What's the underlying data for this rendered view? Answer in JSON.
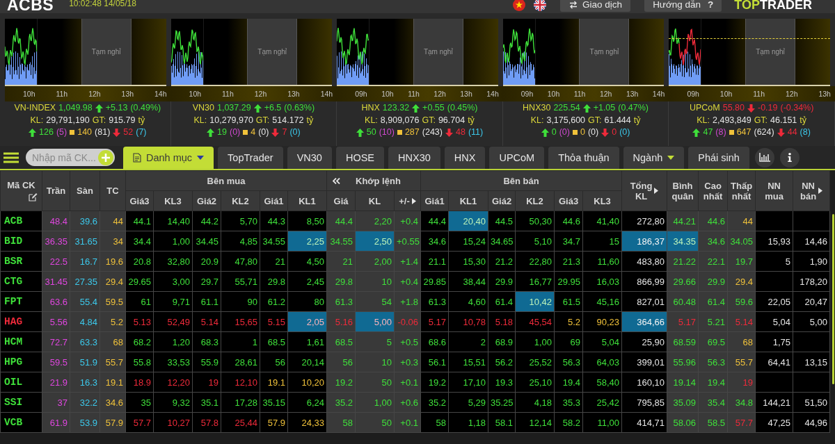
{
  "top_bar": {
    "logo": "ACBS",
    "clock": "10:02:48 14/05/18",
    "buttons": [
      {
        "kind": "trade",
        "label": "Giao dịch"
      },
      {
        "kind": "help",
        "label": "Hướng dẫn",
        "suffix": "?"
      }
    ],
    "brand": {
      "lead": "TOP",
      "rest": "TRADER"
    }
  },
  "indices": [
    {
      "name": "VN-INDEX",
      "value": "1,049.98",
      "kind": "up",
      "change": "+5.13",
      "percent": "(0.49%)",
      "volume_label": "KL:",
      "volume": "29,791,190",
      "turnover_label": "GT:",
      "turnover": "915.79",
      "unit": "tỷ",
      "advances": "126",
      "ceiling": "(5)",
      "unchanged": "140",
      "unchanged_note": "(81)",
      "declines": "52",
      "floor": "(7)",
      "pause_label": "Tạm nghỉ",
      "x_labels": [
        "10h",
        "11h",
        "12h",
        "13h",
        "14h"
      ]
    },
    {
      "name": "VN30",
      "value": "1,037.29",
      "kind": "up",
      "change": "+6.5",
      "percent": "(0.63%)",
      "volume_label": "KL:",
      "volume": "10,279,970",
      "turnover_label": "GT:",
      "turnover": "514.172",
      "unit": "tỷ",
      "advances": "19",
      "ceiling": "(0)",
      "unchanged": "4",
      "unchanged_note": "(0)",
      "declines": "7",
      "floor": "(0)",
      "pause_label": "Tạm nghỉ",
      "x_labels": [
        "10h",
        "11h",
        "12h",
        "13h",
        "14h"
      ]
    },
    {
      "name": "HNX",
      "value": "123.32",
      "kind": "up",
      "change": "+0.55",
      "percent": "(0.45%)",
      "volume_label": "KL:",
      "volume": "8,909,076",
      "turnover_label": "GT:",
      "turnover": "96.704",
      "unit": "tỷ",
      "advances": "50",
      "ceiling": "(10)",
      "unchanged": "287",
      "unchanged_note": "(243)",
      "declines": "48",
      "floor": "(11)",
      "pause_label": "Tạm nghỉ",
      "x_labels": [
        "09h",
        "10h",
        "11h",
        "12h",
        "13h",
        "14h"
      ]
    },
    {
      "name": "HNX30",
      "value": "225.54",
      "kind": "up",
      "change": "+1.05",
      "percent": "(0.47%)",
      "volume_label": "KL:",
      "volume": "3,175,600",
      "turnover_label": "GT:",
      "turnover": "61.444",
      "unit": "tỷ",
      "advances": "0",
      "ceiling": "(0)",
      "unchanged": "0",
      "unchanged_note": "(0)",
      "declines": "0",
      "floor": "(0)",
      "pause_label": "Tạm nghỉ",
      "x_labels": [
        "09h",
        "10h",
        "11h",
        "12h",
        "13h",
        "14h"
      ]
    },
    {
      "name": "UPCoM",
      "value": "55.80",
      "kind": "down",
      "change": "-0.19",
      "percent": "(-0.34%)",
      "volume_label": "KL:",
      "volume": "2,493,849",
      "turnover_label": "GT:",
      "turnover": "46.151",
      "unit": "tỷ",
      "advances": "47",
      "ceiling": "(8)",
      "unchanged": "647",
      "unchanged_note": "(624)",
      "declines": "44",
      "floor": "(8)",
      "pause_label": "Tạm nghỉ",
      "x_labels": [
        "09h",
        "10h",
        "11h",
        "12h",
        "13h"
      ]
    }
  ],
  "toolbar": {
    "search": {
      "placeholder": "Nhập mã CK..."
    },
    "tabs": [
      {
        "label": "Danh mục",
        "kind": "list",
        "selected": true
      },
      {
        "label": "TopTrader",
        "kind": "plain",
        "selected": false
      },
      {
        "label": "VN30",
        "kind": "plain",
        "selected": false
      },
      {
        "label": "HOSE",
        "kind": "plain",
        "selected": false
      },
      {
        "label": "HNX30",
        "kind": "plain",
        "selected": false
      },
      {
        "label": "HNX",
        "kind": "plain",
        "selected": false
      },
      {
        "label": "UPCoM",
        "kind": "plain",
        "selected": false
      },
      {
        "label": "Thỏa thuận",
        "kind": "plain",
        "selected": false
      },
      {
        "label": "Ngành",
        "kind": "menu",
        "selected": false
      },
      {
        "label": "Phái sinh",
        "kind": "plain",
        "selected": false
      }
    ]
  },
  "table": {
    "column_groups": [
      {
        "colspan": 4
      },
      {
        "label": "Bên mua",
        "kind": "plain",
        "colspan": 6
      },
      {
        "label": "Khớp lệnh",
        "kind": "collapse",
        "colspan": 3
      },
      {
        "label": "Bên bán",
        "kind": "plain",
        "colspan": 6
      },
      {
        "colspan": 6
      }
    ],
    "columns": [
      {
        "label": "Mã CK",
        "kind": "edit"
      },
      {
        "label": "Trần",
        "kind": "plain"
      },
      {
        "label": "Sàn",
        "kind": "plain"
      },
      {
        "label": "TC",
        "kind": "plain"
      },
      {
        "label": "Giá3",
        "kind": "plain"
      },
      {
        "label": "KL3",
        "kind": "plain"
      },
      {
        "label": "Giá2",
        "kind": "plain"
      },
      {
        "label": "KL2",
        "kind": "plain"
      },
      {
        "label": "Giá1",
        "kind": "plain"
      },
      {
        "label": "KL1",
        "kind": "plain"
      },
      {
        "label": "Giá",
        "kind": "plain"
      },
      {
        "label": "KL",
        "kind": "plain"
      },
      {
        "label": "+/-",
        "kind": "expand"
      },
      {
        "label": "Giá1",
        "kind": "plain"
      },
      {
        "label": "KL1",
        "kind": "plain"
      },
      {
        "label": "Giá2",
        "kind": "plain"
      },
      {
        "label": "KL2",
        "kind": "plain"
      },
      {
        "label": "Giá3",
        "kind": "plain"
      },
      {
        "label": "KL3",
        "kind": "plain"
      },
      {
        "label": "Tổng KL",
        "kind": "expand"
      },
      {
        "label": "Bình quân",
        "kind": "plain"
      },
      {
        "label": "Cao nhất",
        "kind": "plain"
      },
      {
        "label": "Thấp nhất",
        "kind": "plain"
      },
      {
        "label": "NN mua",
        "kind": "plain"
      },
      {
        "label": "NN bán",
        "kind": "expand"
      }
    ],
    "rows": [
      {
        "cells": [
          {
            "text": "ACB",
            "kind": "up",
            "flash": false
          },
          {
            "text": "48.4",
            "kind": "ceiling",
            "flash": false
          },
          {
            "text": "39.6",
            "kind": "floor",
            "flash": false
          },
          {
            "text": "44",
            "kind": "ref",
            "flash": false
          },
          {
            "text": "44.1",
            "kind": "up",
            "flash": false
          },
          {
            "text": "14,40",
            "kind": "up",
            "flash": false
          },
          {
            "text": "44.2",
            "kind": "up",
            "flash": false
          },
          {
            "text": "5,70",
            "kind": "up",
            "flash": false
          },
          {
            "text": "44.3",
            "kind": "up",
            "flash": false
          },
          {
            "text": "8,50",
            "kind": "up",
            "flash": false
          },
          {
            "text": "44.4",
            "kind": "up",
            "flash": false
          },
          {
            "text": "2,20",
            "kind": "up",
            "flash": false
          },
          {
            "text": "+0.4",
            "kind": "up",
            "flash": false
          },
          {
            "text": "44.4",
            "kind": "up",
            "flash": false
          },
          {
            "text": "20,40",
            "kind": "up",
            "flash": true
          },
          {
            "text": "44.5",
            "kind": "up",
            "flash": false
          },
          {
            "text": "50,30",
            "kind": "up",
            "flash": false
          },
          {
            "text": "44.6",
            "kind": "up",
            "flash": false
          },
          {
            "text": "41,40",
            "kind": "up",
            "flash": false
          },
          {
            "text": "272,80",
            "kind": "plain",
            "flash": false
          },
          {
            "text": "44.21",
            "kind": "up",
            "flash": false
          },
          {
            "text": "44.6",
            "kind": "up",
            "flash": false
          },
          {
            "text": "44",
            "kind": "ref",
            "flash": false
          },
          {
            "flash": false
          },
          {
            "flash": false
          }
        ]
      },
      {
        "cells": [
          {
            "text": "BID",
            "kind": "up",
            "flash": false
          },
          {
            "text": "36.35",
            "kind": "ceiling",
            "flash": false
          },
          {
            "text": "31.65",
            "kind": "floor",
            "flash": false
          },
          {
            "text": "34",
            "kind": "ref",
            "flash": false
          },
          {
            "text": "34.4",
            "kind": "up",
            "flash": false
          },
          {
            "text": "1,00",
            "kind": "up",
            "flash": false
          },
          {
            "text": "34.45",
            "kind": "up",
            "flash": false
          },
          {
            "text": "4,85",
            "kind": "up",
            "flash": false
          },
          {
            "text": "34.55",
            "kind": "up",
            "flash": false
          },
          {
            "text": "2,25",
            "kind": "up",
            "flash": true
          },
          {
            "text": "34.55",
            "kind": "up",
            "flash": false
          },
          {
            "text": "2,50",
            "kind": "up",
            "flash": true
          },
          {
            "text": "+0.55",
            "kind": "up",
            "flash": false
          },
          {
            "text": "34.6",
            "kind": "up",
            "flash": false
          },
          {
            "text": "15,24",
            "kind": "up",
            "flash": false
          },
          {
            "text": "34.65",
            "kind": "up",
            "flash": false
          },
          {
            "text": "5,10",
            "kind": "up",
            "flash": false
          },
          {
            "text": "34.7",
            "kind": "up",
            "flash": false
          },
          {
            "text": "15",
            "kind": "up",
            "flash": false
          },
          {
            "text": "186,37",
            "kind": "plain",
            "flash": true
          },
          {
            "text": "34.35",
            "kind": "up",
            "flash": true
          },
          {
            "text": "34.6",
            "kind": "up",
            "flash": false
          },
          {
            "text": "34.05",
            "kind": "up",
            "flash": false
          },
          {
            "text": "15,93",
            "kind": "plain",
            "flash": false
          },
          {
            "text": "14,46",
            "kind": "plain",
            "flash": false
          }
        ]
      },
      {
        "cells": [
          {
            "text": "BSR",
            "kind": "up",
            "flash": false
          },
          {
            "text": "22.5",
            "kind": "ceiling",
            "flash": false
          },
          {
            "text": "16.7",
            "kind": "floor",
            "flash": false
          },
          {
            "text": "19.6",
            "kind": "ref",
            "flash": false
          },
          {
            "text": "20.8",
            "kind": "up",
            "flash": false
          },
          {
            "text": "32,80",
            "kind": "up",
            "flash": false
          },
          {
            "text": "20.9",
            "kind": "up",
            "flash": false
          },
          {
            "text": "47,80",
            "kind": "up",
            "flash": false
          },
          {
            "text": "21",
            "kind": "up",
            "flash": false
          },
          {
            "text": "4,50",
            "kind": "up",
            "flash": false
          },
          {
            "text": "21",
            "kind": "up",
            "flash": false
          },
          {
            "text": "2,00",
            "kind": "up",
            "flash": false
          },
          {
            "text": "+1.4",
            "kind": "up",
            "flash": false
          },
          {
            "text": "21.1",
            "kind": "up",
            "flash": false
          },
          {
            "text": "15,30",
            "kind": "up",
            "flash": false
          },
          {
            "text": "21.2",
            "kind": "up",
            "flash": false
          },
          {
            "text": "22,80",
            "kind": "up",
            "flash": false
          },
          {
            "text": "21.3",
            "kind": "up",
            "flash": false
          },
          {
            "text": "11,60",
            "kind": "up",
            "flash": false
          },
          {
            "text": "483,80",
            "kind": "plain",
            "flash": false
          },
          {
            "text": "21.22",
            "kind": "up",
            "flash": false
          },
          {
            "text": "22.1",
            "kind": "up",
            "flash": false
          },
          {
            "text": "19.7",
            "kind": "up",
            "flash": false
          },
          {
            "text": "5",
            "kind": "plain",
            "flash": false
          },
          {
            "text": "1,90",
            "kind": "plain",
            "flash": false
          }
        ]
      },
      {
        "cells": [
          {
            "text": "CTG",
            "kind": "up",
            "flash": false
          },
          {
            "text": "31.45",
            "kind": "ceiling",
            "flash": false
          },
          {
            "text": "27.35",
            "kind": "floor",
            "flash": false
          },
          {
            "text": "29.4",
            "kind": "ref",
            "flash": false
          },
          {
            "text": "29.65",
            "kind": "up",
            "flash": false
          },
          {
            "text": "3,00",
            "kind": "up",
            "flash": false
          },
          {
            "text": "29.7",
            "kind": "up",
            "flash": false
          },
          {
            "text": "55,71",
            "kind": "up",
            "flash": false
          },
          {
            "text": "29.8",
            "kind": "up",
            "flash": false
          },
          {
            "text": "2,45",
            "kind": "up",
            "flash": false
          },
          {
            "text": "29.8",
            "kind": "up",
            "flash": false
          },
          {
            "text": "10",
            "kind": "up",
            "flash": false
          },
          {
            "text": "+0.4",
            "kind": "up",
            "flash": false
          },
          {
            "text": "29.85",
            "kind": "up",
            "flash": false
          },
          {
            "text": "38,44",
            "kind": "up",
            "flash": false
          },
          {
            "text": "29.9",
            "kind": "up",
            "flash": false
          },
          {
            "text": "16,77",
            "kind": "up",
            "flash": false
          },
          {
            "text": "29.95",
            "kind": "up",
            "flash": false
          },
          {
            "text": "16,03",
            "kind": "up",
            "flash": false
          },
          {
            "text": "866,99",
            "kind": "plain",
            "flash": false
          },
          {
            "text": "29.66",
            "kind": "up",
            "flash": false
          },
          {
            "text": "29.9",
            "kind": "up",
            "flash": false
          },
          {
            "text": "29.4",
            "kind": "ref",
            "flash": false
          },
          {
            "flash": false
          },
          {
            "text": "178,20",
            "kind": "plain",
            "flash": false
          }
        ]
      },
      {
        "cells": [
          {
            "text": "FPT",
            "kind": "up",
            "flash": false
          },
          {
            "text": "63.6",
            "kind": "ceiling",
            "flash": false
          },
          {
            "text": "55.4",
            "kind": "floor",
            "flash": false
          },
          {
            "text": "59.5",
            "kind": "ref",
            "flash": false
          },
          {
            "text": "61",
            "kind": "up",
            "flash": false
          },
          {
            "text": "9,71",
            "kind": "up",
            "flash": false
          },
          {
            "text": "61.1",
            "kind": "up",
            "flash": false
          },
          {
            "text": "90",
            "kind": "up",
            "flash": false
          },
          {
            "text": "61.2",
            "kind": "up",
            "flash": false
          },
          {
            "text": "80",
            "kind": "up",
            "flash": false
          },
          {
            "text": "61.3",
            "kind": "up",
            "flash": false
          },
          {
            "text": "54",
            "kind": "up",
            "flash": false
          },
          {
            "text": "+1.8",
            "kind": "up",
            "flash": false
          },
          {
            "text": "61.3",
            "kind": "up",
            "flash": false
          },
          {
            "text": "4,60",
            "kind": "up",
            "flash": false
          },
          {
            "text": "61.4",
            "kind": "up",
            "flash": false
          },
          {
            "text": "10,42",
            "kind": "up",
            "flash": true
          },
          {
            "text": "61.5",
            "kind": "up",
            "flash": false
          },
          {
            "text": "45,16",
            "kind": "up",
            "flash": false
          },
          {
            "text": "827,01",
            "kind": "plain",
            "flash": false
          },
          {
            "text": "60.48",
            "kind": "up",
            "flash": false
          },
          {
            "text": "61.4",
            "kind": "up",
            "flash": false
          },
          {
            "text": "59.6",
            "kind": "up",
            "flash": false
          },
          {
            "text": "22,05",
            "kind": "plain",
            "flash": false
          },
          {
            "text": "20,47",
            "kind": "plain",
            "flash": false
          }
        ]
      },
      {
        "cells": [
          {
            "text": "HAG",
            "kind": "down",
            "flash": false
          },
          {
            "text": "5.56",
            "kind": "ceiling",
            "flash": false
          },
          {
            "text": "4.84",
            "kind": "floor",
            "flash": false
          },
          {
            "text": "5.2",
            "kind": "ref",
            "flash": false
          },
          {
            "text": "5.13",
            "kind": "down",
            "flash": false
          },
          {
            "text": "52,49",
            "kind": "down",
            "flash": false
          },
          {
            "text": "5.14",
            "kind": "down",
            "flash": false
          },
          {
            "text": "15,65",
            "kind": "down",
            "flash": false
          },
          {
            "text": "5.15",
            "kind": "down",
            "flash": false
          },
          {
            "text": "2,05",
            "kind": "down",
            "flash": true
          },
          {
            "text": "5.16",
            "kind": "down",
            "flash": false
          },
          {
            "text": "5,00",
            "kind": "down",
            "flash": true
          },
          {
            "text": "-0.06",
            "kind": "down",
            "flash": false
          },
          {
            "text": "5.17",
            "kind": "down",
            "flash": false
          },
          {
            "text": "10,78",
            "kind": "down",
            "flash": false
          },
          {
            "text": "5.18",
            "kind": "down",
            "flash": false
          },
          {
            "text": "45,54",
            "kind": "down",
            "flash": false
          },
          {
            "text": "5.2",
            "kind": "ref",
            "flash": false
          },
          {
            "text": "90,23",
            "kind": "ref",
            "flash": false
          },
          {
            "text": "364,66",
            "kind": "plain",
            "flash": true
          },
          {
            "text": "5.17",
            "kind": "down",
            "flash": false
          },
          {
            "text": "5.21",
            "kind": "up",
            "flash": false
          },
          {
            "text": "5.14",
            "kind": "down",
            "flash": false
          },
          {
            "text": "5,04",
            "kind": "plain",
            "flash": false
          },
          {
            "text": "5,00",
            "kind": "plain",
            "flash": false
          }
        ]
      },
      {
        "cells": [
          {
            "text": "HCM",
            "kind": "up",
            "flash": false
          },
          {
            "text": "72.7",
            "kind": "ceiling",
            "flash": false
          },
          {
            "text": "63.3",
            "kind": "floor",
            "flash": false
          },
          {
            "text": "68",
            "kind": "ref",
            "flash": false
          },
          {
            "text": "68.2",
            "kind": "up",
            "flash": false
          },
          {
            "text": "1,20",
            "kind": "up",
            "flash": false
          },
          {
            "text": "68.3",
            "kind": "up",
            "flash": false
          },
          {
            "text": "1",
            "kind": "up",
            "flash": false
          },
          {
            "text": "68.5",
            "kind": "up",
            "flash": false
          },
          {
            "text": "1,61",
            "kind": "up",
            "flash": false
          },
          {
            "text": "68.5",
            "kind": "up",
            "flash": false
          },
          {
            "text": "5",
            "kind": "up",
            "flash": false
          },
          {
            "text": "+0.5",
            "kind": "up",
            "flash": false
          },
          {
            "text": "68.6",
            "kind": "up",
            "flash": false
          },
          {
            "text": "2",
            "kind": "up",
            "flash": false
          },
          {
            "text": "68.9",
            "kind": "up",
            "flash": false
          },
          {
            "text": "1,00",
            "kind": "up",
            "flash": false
          },
          {
            "text": "69",
            "kind": "up",
            "flash": false
          },
          {
            "text": "5,04",
            "kind": "up",
            "flash": false
          },
          {
            "text": "25,90",
            "kind": "plain",
            "flash": false
          },
          {
            "text": "68.59",
            "kind": "up",
            "flash": false
          },
          {
            "text": "69.5",
            "kind": "up",
            "flash": false
          },
          {
            "text": "68",
            "kind": "ref",
            "flash": false
          },
          {
            "text": "1,75",
            "kind": "plain",
            "flash": false
          },
          {
            "flash": false
          }
        ]
      },
      {
        "cells": [
          {
            "text": "HPG",
            "kind": "up",
            "flash": false
          },
          {
            "text": "59.5",
            "kind": "ceiling",
            "flash": false
          },
          {
            "text": "51.9",
            "kind": "floor",
            "flash": false
          },
          {
            "text": "55.7",
            "kind": "ref",
            "flash": false
          },
          {
            "text": "55.8",
            "kind": "up",
            "flash": false
          },
          {
            "text": "33,53",
            "kind": "up",
            "flash": false
          },
          {
            "text": "55.9",
            "kind": "up",
            "flash": false
          },
          {
            "text": "28,61",
            "kind": "up",
            "flash": false
          },
          {
            "text": "56",
            "kind": "up",
            "flash": false
          },
          {
            "text": "20,14",
            "kind": "up",
            "flash": false
          },
          {
            "text": "56",
            "kind": "up",
            "flash": false
          },
          {
            "text": "10",
            "kind": "up",
            "flash": false
          },
          {
            "text": "+0.3",
            "kind": "up",
            "flash": false
          },
          {
            "text": "56.1",
            "kind": "up",
            "flash": false
          },
          {
            "text": "15,51",
            "kind": "up",
            "flash": false
          },
          {
            "text": "56.2",
            "kind": "up",
            "flash": false
          },
          {
            "text": "25,52",
            "kind": "up",
            "flash": false
          },
          {
            "text": "56.3",
            "kind": "up",
            "flash": false
          },
          {
            "text": "64,03",
            "kind": "up",
            "flash": false
          },
          {
            "text": "399,01",
            "kind": "plain",
            "flash": false
          },
          {
            "text": "55.96",
            "kind": "up",
            "flash": false
          },
          {
            "text": "56.3",
            "kind": "up",
            "flash": false
          },
          {
            "text": "55.7",
            "kind": "ref",
            "flash": false
          },
          {
            "text": "64,41",
            "kind": "plain",
            "flash": false
          },
          {
            "text": "13,15",
            "kind": "plain",
            "flash": false
          }
        ]
      },
      {
        "cells": [
          {
            "text": "OIL",
            "kind": "up",
            "flash": false
          },
          {
            "text": "21.9",
            "kind": "ceiling",
            "flash": false
          },
          {
            "text": "16.3",
            "kind": "floor",
            "flash": false
          },
          {
            "text": "19.1",
            "kind": "ref",
            "flash": false
          },
          {
            "text": "18.9",
            "kind": "down",
            "flash": false
          },
          {
            "text": "12,20",
            "kind": "down",
            "flash": false
          },
          {
            "text": "19",
            "kind": "down",
            "flash": false
          },
          {
            "text": "12,10",
            "kind": "down",
            "flash": false
          },
          {
            "text": "19.1",
            "kind": "ref",
            "flash": false
          },
          {
            "text": "10,20",
            "kind": "ref",
            "flash": false
          },
          {
            "text": "19.2",
            "kind": "up",
            "flash": false
          },
          {
            "text": "50",
            "kind": "up",
            "flash": false
          },
          {
            "text": "+0.1",
            "kind": "up",
            "flash": false
          },
          {
            "text": "19.2",
            "kind": "up",
            "flash": false
          },
          {
            "text": "17,10",
            "kind": "up",
            "flash": false
          },
          {
            "text": "19.3",
            "kind": "up",
            "flash": false
          },
          {
            "text": "25,10",
            "kind": "up",
            "flash": false
          },
          {
            "text": "19.4",
            "kind": "up",
            "flash": false
          },
          {
            "text": "58,40",
            "kind": "up",
            "flash": false
          },
          {
            "text": "160,10",
            "kind": "plain",
            "flash": false
          },
          {
            "text": "19.14",
            "kind": "up",
            "flash": false
          },
          {
            "text": "19.4",
            "kind": "up",
            "flash": false
          },
          {
            "text": "19",
            "kind": "down",
            "flash": false
          },
          {
            "flash": false
          },
          {
            "flash": false
          }
        ]
      },
      {
        "cells": [
          {
            "text": "SSI",
            "kind": "up",
            "flash": false
          },
          {
            "text": "37",
            "kind": "ceiling",
            "flash": false
          },
          {
            "text": "32.2",
            "kind": "floor",
            "flash": false
          },
          {
            "text": "34.6",
            "kind": "ref",
            "flash": false
          },
          {
            "text": "35",
            "kind": "up",
            "flash": false
          },
          {
            "text": "9,32",
            "kind": "up",
            "flash": false
          },
          {
            "text": "35.1",
            "kind": "up",
            "flash": false
          },
          {
            "text": "17,28",
            "kind": "up",
            "flash": false
          },
          {
            "text": "35.15",
            "kind": "up",
            "flash": false
          },
          {
            "text": "6,24",
            "kind": "up",
            "flash": false
          },
          {
            "text": "35.2",
            "kind": "up",
            "flash": false
          },
          {
            "text": "1,00",
            "kind": "up",
            "flash": false
          },
          {
            "text": "+0.6",
            "kind": "up",
            "flash": false
          },
          {
            "text": "35.2",
            "kind": "up",
            "flash": false
          },
          {
            "text": "5,29",
            "kind": "up",
            "flash": false
          },
          {
            "text": "35.25",
            "kind": "up",
            "flash": false
          },
          {
            "text": "4,18",
            "kind": "up",
            "flash": false
          },
          {
            "text": "35.3",
            "kind": "up",
            "flash": false
          },
          {
            "text": "25,42",
            "kind": "up",
            "flash": false
          },
          {
            "text": "795,85",
            "kind": "plain",
            "flash": false
          },
          {
            "text": "35.09",
            "kind": "up",
            "flash": false
          },
          {
            "text": "35.4",
            "kind": "up",
            "flash": false
          },
          {
            "text": "34.8",
            "kind": "up",
            "flash": false
          },
          {
            "text": "144,21",
            "kind": "plain",
            "flash": false
          },
          {
            "text": "51,50",
            "kind": "plain",
            "flash": false
          }
        ]
      },
      {
        "cells": [
          {
            "text": "VCB",
            "kind": "up",
            "flash": false
          },
          {
            "text": "61.9",
            "kind": "ceiling",
            "flash": false
          },
          {
            "text": "53.9",
            "kind": "floor",
            "flash": false
          },
          {
            "text": "57.9",
            "kind": "ref",
            "flash": false
          },
          {
            "text": "57.7",
            "kind": "down",
            "flash": false
          },
          {
            "text": "10,27",
            "kind": "down",
            "flash": false
          },
          {
            "text": "57.8",
            "kind": "down",
            "flash": false
          },
          {
            "text": "25,44",
            "kind": "down",
            "flash": false
          },
          {
            "text": "57.9",
            "kind": "ref",
            "flash": false
          },
          {
            "text": "24,33",
            "kind": "ref",
            "flash": false
          },
          {
            "text": "58",
            "kind": "up",
            "flash": false
          },
          {
            "text": "50",
            "kind": "up",
            "flash": false
          },
          {
            "text": "+0.1",
            "kind": "up",
            "flash": false
          },
          {
            "text": "58",
            "kind": "up",
            "flash": false
          },
          {
            "text": "1,18",
            "kind": "up",
            "flash": false
          },
          {
            "text": "58.1",
            "kind": "up",
            "flash": false
          },
          {
            "text": "12,14",
            "kind": "up",
            "flash": false
          },
          {
            "text": "58.2",
            "kind": "up",
            "flash": false
          },
          {
            "text": "11,00",
            "kind": "up",
            "flash": false
          },
          {
            "text": "414,71",
            "kind": "plain",
            "flash": false
          },
          {
            "text": "58.06",
            "kind": "up",
            "flash": false
          },
          {
            "text": "58.5",
            "kind": "up",
            "flash": false
          },
          {
            "text": "57.7",
            "kind": "down",
            "flash": false
          },
          {
            "text": "47,25",
            "kind": "plain",
            "flash": false
          },
          {
            "text": "44,96",
            "kind": "plain",
            "flash": false
          }
        ]
      }
    ]
  }
}
